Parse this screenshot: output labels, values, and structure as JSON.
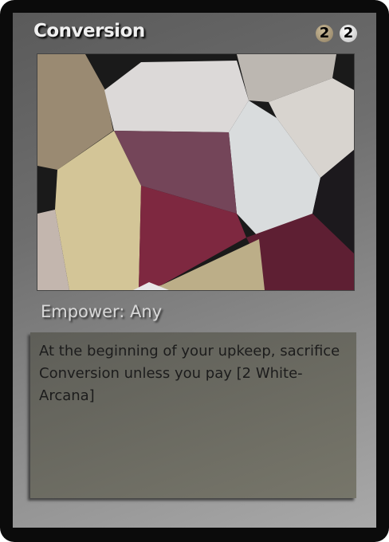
{
  "card": {
    "title": "Conversion",
    "cost": [
      {
        "value": "2",
        "color": "#b3a27f",
        "type": "tan-arcana"
      },
      {
        "value": "2",
        "color": "#ffffff",
        "type": "white-arcana"
      }
    ],
    "empower": "Empower: Any",
    "rules_text": "At the beginning of your upkeep, sacrifice Conversion unless you pay [2 White-Arcana]"
  }
}
